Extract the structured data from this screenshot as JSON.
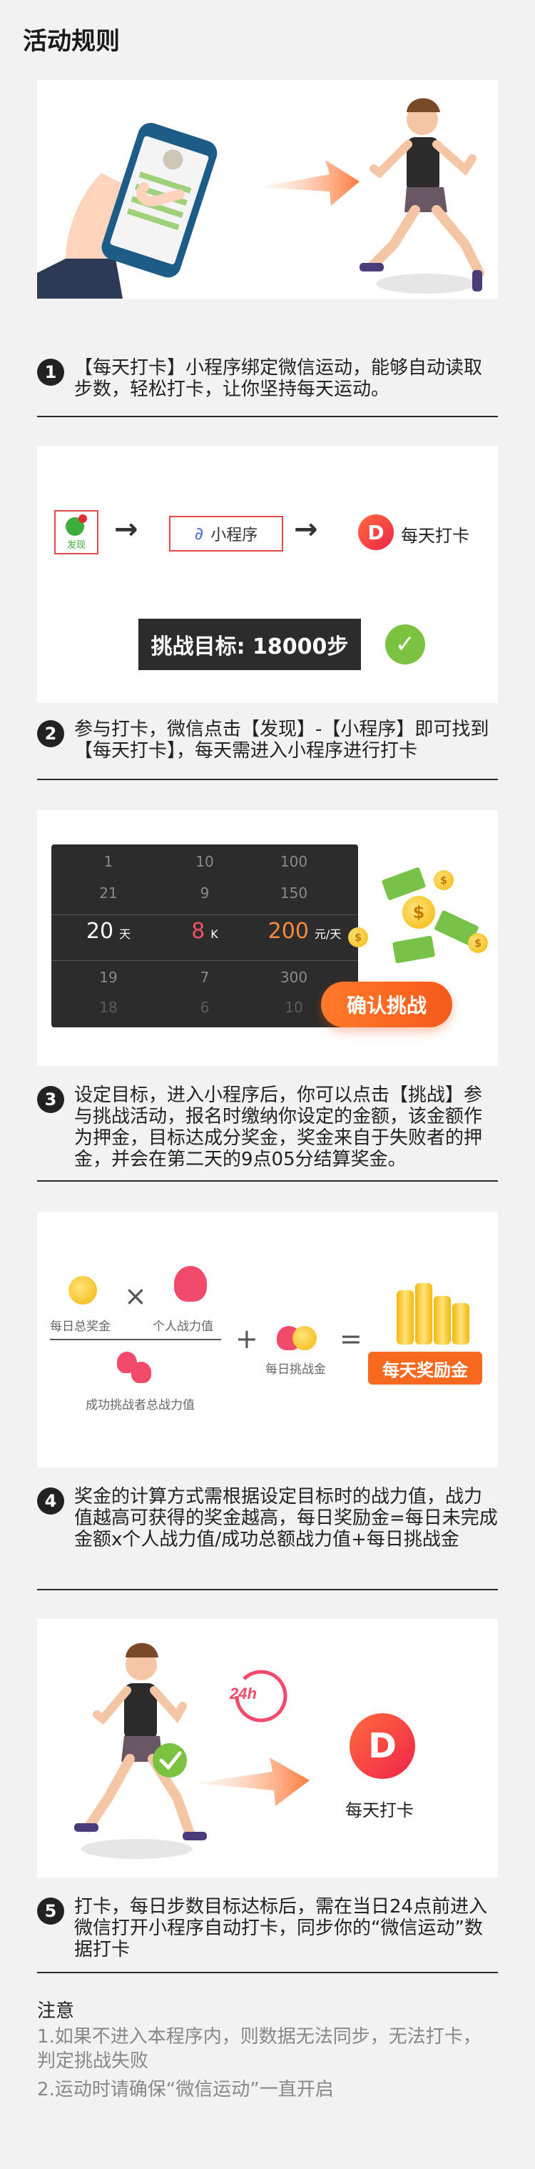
{
  "page": {
    "title": "活动规则"
  },
  "brand": {
    "name": "每天打卡"
  },
  "steps": [
    {
      "num": "1",
      "text": "【每天打卡】小程序绑定微信运动，能够自动读取步数，轻松打卡，让你坚持每天运动。"
    },
    {
      "num": "2",
      "text": "参与打卡，微信点击【发现】-【小程序】即可找到【每天打卡】，每天需进入小程序进行打卡"
    },
    {
      "num": "3",
      "text": "设定目标，进入小程序后，你可以点击【挑战】参与挑战活动，报名时缴纳你设定的金额，该金额作为押金，目标达成分奖金，奖金来自于失败者的押金，并会在第二天的9点05分结算奖金。"
    },
    {
      "num": "4",
      "text": "奖金的计算方式需根据设定目标时的战力值，战力值越高可获得的奖金越高，每日奖励金=每日未完成金额x个人战力值/成功总额战力值+每日挑战金"
    },
    {
      "num": "5",
      "text": "打卡，每日步数目标达标后，需在当日24点前进入微信打开小程序自动打卡，同步你的“微信运动”数据打卡"
    }
  ],
  "card2": {
    "find_label": "发现",
    "mini_label": "小程序",
    "goal_text": "挑战目标: 18000步"
  },
  "card3": {
    "picker_rows": [
      [
        "1",
        "10",
        "100"
      ],
      [
        "21",
        "9",
        "150"
      ],
      [
        "20",
        "8",
        "200"
      ],
      [
        "19",
        "7",
        "300"
      ],
      [
        "18",
        "6",
        "10"
      ]
    ],
    "units": [
      "天",
      "K",
      "元/天"
    ],
    "confirm_label": "确认挑战",
    "coin_symbol": "$"
  },
  "card4": {
    "label_daily_pool": "每日总奖金",
    "label_personal_power": "个人战力值",
    "label_success_power": "成功挑战者总战力值",
    "label_daily_challenge": "每日挑战金",
    "op_times": "×",
    "op_plus": "+",
    "op_equals": "=",
    "reward_label": "每天奖励金"
  },
  "card5": {
    "clock_label": "24h"
  },
  "notes": {
    "title": "注意",
    "items": [
      "1.如果不进入本程序内，则数据无法同步，无法打卡，判定挑战失败",
      "2.运动时请确保“微信运动”一直开启"
    ]
  },
  "colors": {
    "accent_orange": "#f56a1e",
    "brand_red": "#f0244a",
    "success_green": "#7cc241",
    "dark": "#2c2c2c"
  }
}
